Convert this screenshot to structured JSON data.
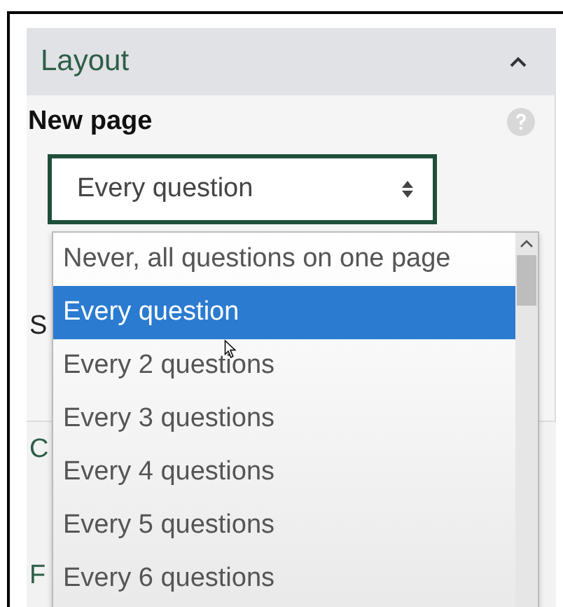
{
  "section": {
    "title": "Layout",
    "expanded": true
  },
  "field": {
    "label": "New page",
    "value": "Every question"
  },
  "hidden_labels": [
    "S",
    "C",
    "F"
  ],
  "dropdown": {
    "options": [
      {
        "label": "Never, all questions on one page",
        "selected": false
      },
      {
        "label": "Every question",
        "selected": true
      },
      {
        "label": "Every 2 questions",
        "selected": false
      },
      {
        "label": "Every 3 questions",
        "selected": false
      },
      {
        "label": "Every 4 questions",
        "selected": false
      },
      {
        "label": "Every 5 questions",
        "selected": false
      },
      {
        "label": "Every 6 questions",
        "selected": false
      }
    ]
  }
}
